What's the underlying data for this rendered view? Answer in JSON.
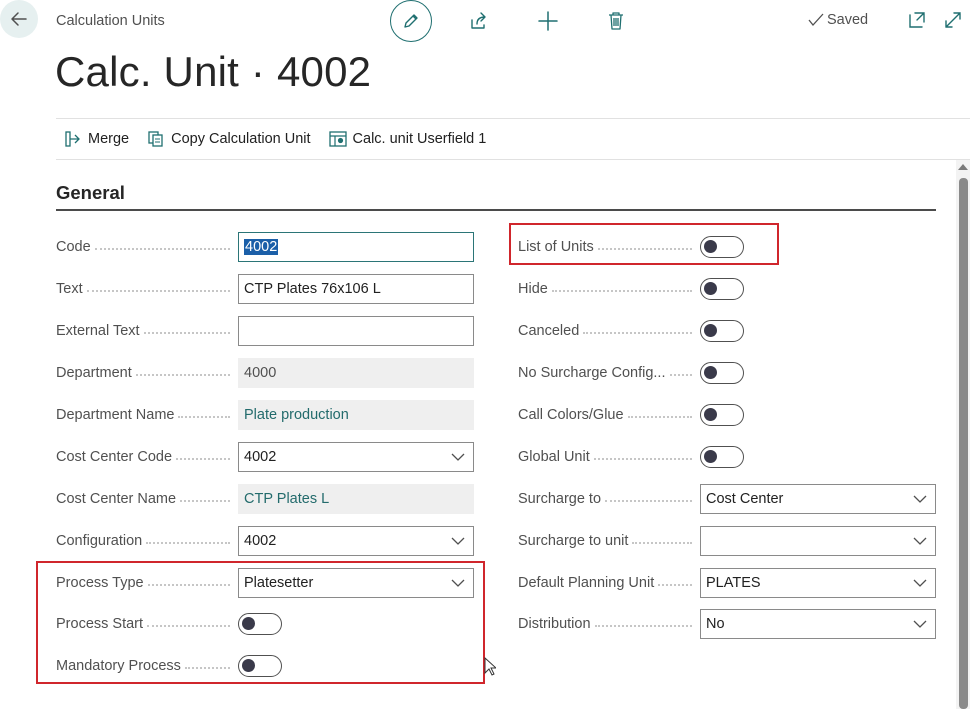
{
  "header": {
    "breadcrumb": "Calculation Units",
    "title": "Calc. Unit · 4002",
    "saved_label": "Saved"
  },
  "actions": [
    {
      "label": "Merge",
      "icon": "merge-icon"
    },
    {
      "label": "Copy Calculation Unit",
      "icon": "copy-icon"
    },
    {
      "label": "Calc. unit Userfield 1",
      "icon": "userfield-icon"
    }
  ],
  "section": {
    "title": "General"
  },
  "left_fields": [
    {
      "label": "Code",
      "value": "4002"
    },
    {
      "label": "Text",
      "value": "CTP Plates 76x106 L"
    },
    {
      "label": "External Text",
      "value": ""
    },
    {
      "label": "Department",
      "value": "4000"
    },
    {
      "label": "Department Name",
      "value": "Plate production"
    },
    {
      "label": "Cost Center Code",
      "value": "4002"
    },
    {
      "label": "Cost Center Name",
      "value": "CTP Plates L"
    },
    {
      "label": "Configuration",
      "value": "4002"
    },
    {
      "label": "Process Type",
      "value": "Platesetter"
    },
    {
      "label": "Process Start",
      "value": false
    },
    {
      "label": "Mandatory Process",
      "value": false
    }
  ],
  "right_fields": [
    {
      "label": "List of Units",
      "value": false
    },
    {
      "label": "Hide",
      "value": false
    },
    {
      "label": "Canceled",
      "value": false
    },
    {
      "label": "No Surcharge Config...",
      "value": false
    },
    {
      "label": "Call Colors/Glue",
      "value": false
    },
    {
      "label": "Global Unit",
      "value": false
    },
    {
      "label": "Surcharge to",
      "value": "Cost Center"
    },
    {
      "label": "Surcharge to unit",
      "value": ""
    },
    {
      "label": "Default Planning Unit",
      "value": "PLATES"
    },
    {
      "label": "Distribution",
      "value": "No"
    }
  ],
  "colors": {
    "accent": "#1f6f70",
    "highlight": "#d0262c",
    "readonly_text": "#236b6c",
    "selection": "#1b5fa8"
  }
}
